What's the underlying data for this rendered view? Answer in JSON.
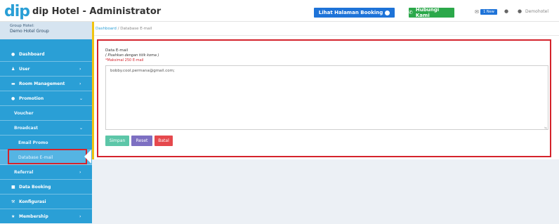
{
  "header": {
    "logo_mark": "dip",
    "app_title": "dip Hotel - Administrator",
    "booking_button": "Lihat Halaman Booking",
    "contact_button": "Hubungi Kami",
    "new_badge": "1 New",
    "user_name": "Demohotel"
  },
  "sidebar": {
    "group_label": "Group Hotel:",
    "group_name": "Demo Hotel Group",
    "items": [
      {
        "label": "Dashboard",
        "icon": "dashboard-icon"
      },
      {
        "label": "User",
        "icon": "user-icon"
      },
      {
        "label": "Room Management",
        "icon": "room-icon"
      },
      {
        "label": "Promotion",
        "icon": "promotion-icon"
      },
      {
        "label": "Voucher"
      },
      {
        "label": "Broadcast"
      },
      {
        "label": "Email Promo"
      },
      {
        "label": "Database E-mail"
      },
      {
        "label": "Referral"
      },
      {
        "label": "Data Booking",
        "icon": "booking-icon"
      },
      {
        "label": "Konfigurasi",
        "icon": "config-icon"
      },
      {
        "label": "Membership",
        "icon": "membership-icon"
      }
    ]
  },
  "breadcrumb": {
    "home": "Dashboard",
    "separator": "/",
    "current": "Database E-mail"
  },
  "form": {
    "title": "Data E-mail",
    "hint": "( Pisahkan dengan titik koma )",
    "limit": "*Maksimal 250 E-mail",
    "email_value": "bobby.cool.permana@gmail.com;",
    "save_label": "Simpan",
    "reset_label": "Reset",
    "cancel_label": "Batal"
  },
  "colors": {
    "sidebar": "#2a9fd6",
    "highlight": "#d4232c",
    "booking_button": "#1e73d8",
    "contact_button": "#2ba84a"
  }
}
